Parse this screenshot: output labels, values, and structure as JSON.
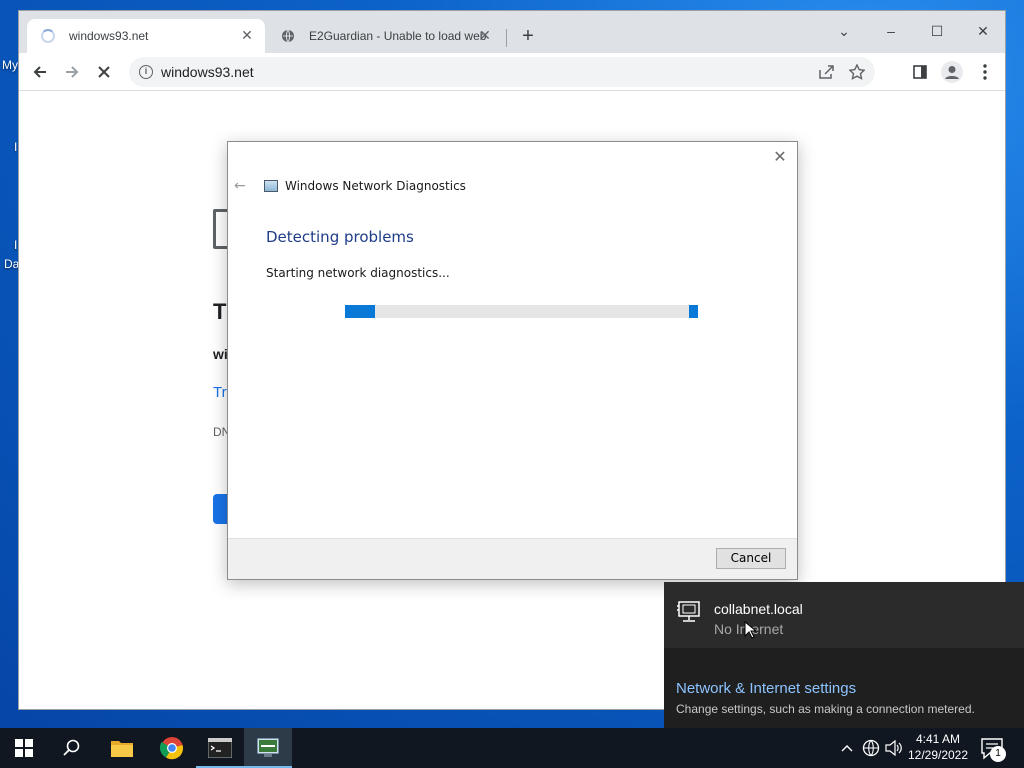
{
  "desktop": {
    "labels": [
      "My",
      "I",
      "I",
      "Da"
    ]
  },
  "browser": {
    "tabs": [
      {
        "title": "windows93.net",
        "loading": true
      },
      {
        "title": "E2Guardian - Unable to load web",
        "loading": false
      }
    ],
    "new_tab": "+",
    "window_controls": {
      "dropdown": "⌄",
      "minimize": "–",
      "maximize": "☐",
      "close": "✕"
    },
    "address": "windows93.net",
    "info_glyph": "i",
    "page_fragments": {
      "title": "Tl",
      "domain": "wi",
      "try_link": "Try",
      "error_code": "DN"
    }
  },
  "dialog": {
    "app_title": "Windows Network Diagnostics",
    "heading": "Detecting problems",
    "status": "Starting network diagnostics...",
    "cancel_label": "Cancel",
    "close_glyph": "✕",
    "back_glyph": "←"
  },
  "network_flyout": {
    "network_name": "collabnet.local",
    "network_status": "No Internet",
    "settings_title": "Network & Internet settings",
    "settings_subtitle": "Change settings, such as making a connection metered."
  },
  "taskbar": {
    "apps": [
      "start",
      "search",
      "file-explorer",
      "chrome",
      "command-prompt",
      "network-diagnostics"
    ],
    "clock_time": "4:41 AM",
    "clock_date": "12/29/2022",
    "notification_count": "1"
  },
  "colors": {
    "accent": "#0a78d7",
    "link": "#1a73e8",
    "flyout_link": "#8dc4ff",
    "dialog_heading": "#1e3c87"
  }
}
